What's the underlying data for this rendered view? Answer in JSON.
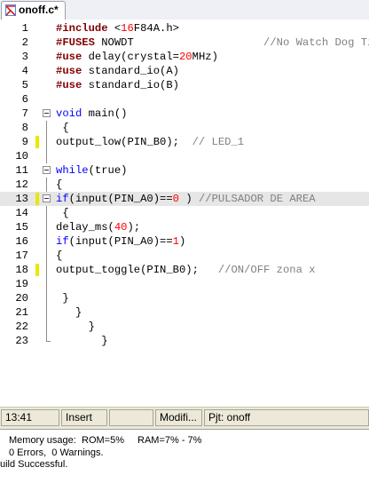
{
  "tab": {
    "title": "onoff.c*",
    "icon": "c-source-file-icon"
  },
  "editor": {
    "current_line": 13,
    "modified_lines": [
      9,
      13,
      18
    ],
    "lines": [
      {
        "n": "1",
        "fold": "",
        "tokens": [
          [
            "pp",
            "#include "
          ],
          [
            "",
            "<"
          ],
          [
            "num",
            "16"
          ],
          [
            "",
            "F84A.h>"
          ]
        ]
      },
      {
        "n": "2",
        "fold": "",
        "tokens": [
          [
            "pp",
            "#FUSES "
          ],
          [
            "",
            "NOWDT                    "
          ],
          [
            "cm",
            "//No Watch Dog Timer"
          ]
        ]
      },
      {
        "n": "3",
        "fold": "",
        "tokens": [
          [
            "pp",
            "#use "
          ],
          [
            "",
            "delay(crystal="
          ],
          [
            "num",
            "20"
          ],
          [
            "",
            "MHz)"
          ]
        ]
      },
      {
        "n": "4",
        "fold": "",
        "tokens": [
          [
            "pp",
            "#use "
          ],
          [
            "",
            "standard_io(A)"
          ]
        ]
      },
      {
        "n": "5",
        "fold": "",
        "tokens": [
          [
            "pp",
            "#use "
          ],
          [
            "",
            "standard_io(B)"
          ]
        ]
      },
      {
        "n": "6",
        "fold": "",
        "tokens": []
      },
      {
        "n": "7",
        "fold": "box",
        "tokens": [
          [
            "kw",
            "void "
          ],
          [
            "",
            "main()"
          ]
        ]
      },
      {
        "n": "8",
        "fold": "line",
        "tokens": [
          [
            "",
            " {"
          ]
        ]
      },
      {
        "n": "9",
        "fold": "line",
        "tokens": [
          [
            "",
            "output_low(PIN_B0);  "
          ],
          [
            "cm",
            "// LED_1"
          ]
        ]
      },
      {
        "n": "10",
        "fold": "line",
        "tokens": []
      },
      {
        "n": "11",
        "fold": "box",
        "tokens": [
          [
            "kw",
            "while"
          ],
          [
            "",
            "(true)"
          ]
        ]
      },
      {
        "n": "12",
        "fold": "line",
        "tokens": [
          [
            "",
            "{"
          ]
        ]
      },
      {
        "n": "13",
        "fold": "box",
        "tokens": [
          [
            "kw",
            "if"
          ],
          [
            "",
            "(input(PIN_A0)=="
          ],
          [
            "num",
            "0"
          ],
          [
            "",
            " ) "
          ],
          [
            "cm",
            "//PULSADOR DE AREA"
          ]
        ]
      },
      {
        "n": "14",
        "fold": "line",
        "tokens": [
          [
            "",
            " {"
          ]
        ]
      },
      {
        "n": "15",
        "fold": "line",
        "tokens": [
          [
            "",
            "delay_ms("
          ],
          [
            "num",
            "40"
          ],
          [
            "",
            ");"
          ]
        ]
      },
      {
        "n": "16",
        "fold": "line",
        "tokens": [
          [
            "kw",
            "if"
          ],
          [
            "",
            "(input(PIN_A0)=="
          ],
          [
            "num",
            "1"
          ],
          [
            "",
            ")"
          ]
        ]
      },
      {
        "n": "17",
        "fold": "line",
        "tokens": [
          [
            "",
            "{"
          ]
        ]
      },
      {
        "n": "18",
        "fold": "line",
        "tokens": [
          [
            "",
            "output_toggle(PIN_B0);   "
          ],
          [
            "cm",
            "//ON/OFF zona x"
          ]
        ]
      },
      {
        "n": "19",
        "fold": "line",
        "tokens": []
      },
      {
        "n": "20",
        "fold": "line",
        "tokens": [
          [
            "",
            " }"
          ]
        ]
      },
      {
        "n": "21",
        "fold": "line",
        "tokens": [
          [
            "",
            "   }"
          ]
        ]
      },
      {
        "n": "22",
        "fold": "line",
        "tokens": [
          [
            "",
            "     }"
          ]
        ]
      },
      {
        "n": "23",
        "fold": "end",
        "tokens": [
          [
            "",
            "       }"
          ]
        ]
      }
    ]
  },
  "statusbar": {
    "position": "13:41",
    "mode": "Insert",
    "extra": "",
    "modified": "Modifi...",
    "project": "Pjt: onoff"
  },
  "output": {
    "memory_label": "Memory usage:",
    "rom": "ROM=5%",
    "ram": "RAM=7% - 7%",
    "errors": "0 Errors,  0 Warnings.",
    "build": "uild Successful."
  }
}
